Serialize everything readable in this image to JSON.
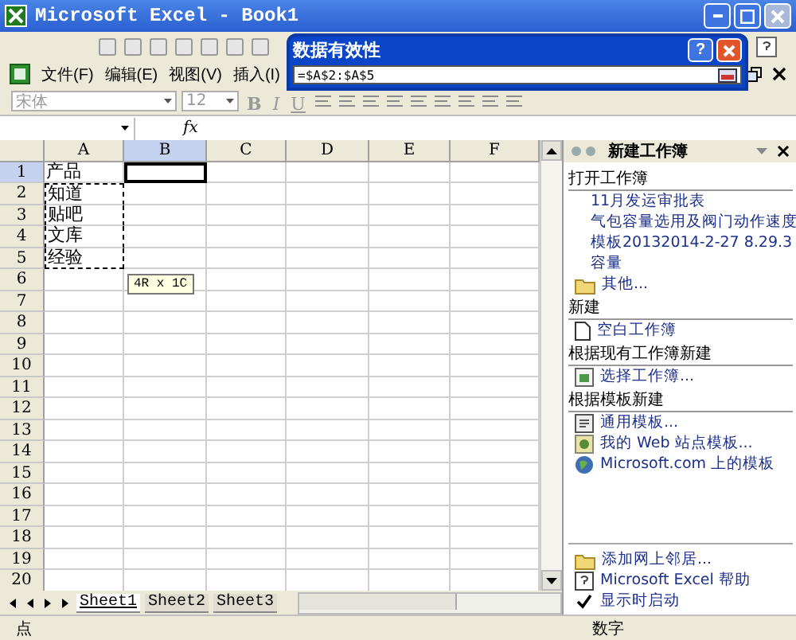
{
  "window": {
    "title": "Microsoft Excel - Book1"
  },
  "menu": [
    {
      "label": "文件(F)"
    },
    {
      "label": "编辑(E)"
    },
    {
      "label": "视图(V)"
    },
    {
      "label": "插入(I)"
    }
  ],
  "format_toolbar": {
    "font": "宋体",
    "size": "12",
    "buttons": [
      "B",
      "I",
      "U"
    ]
  },
  "formula_bar": {
    "fx": "fx"
  },
  "dialog": {
    "title": "数据有效性",
    "help": "?",
    "value": "=$A$2:$A$5"
  },
  "grid": {
    "columns": [
      {
        "label": "A",
        "selected": false
      },
      {
        "label": "B",
        "selected": true
      },
      {
        "label": "C",
        "selected": false
      },
      {
        "label": "D",
        "selected": false
      },
      {
        "label": "E",
        "selected": false
      },
      {
        "label": "F",
        "selected": false
      }
    ],
    "rows": [
      {
        "header": "1",
        "selected": true,
        "value": "产品",
        "marquee": false
      },
      {
        "header": "2",
        "selected": false,
        "value": "知道",
        "marquee": true
      },
      {
        "header": "3",
        "selected": false,
        "value": "贴吧",
        "marquee": true
      },
      {
        "header": "4",
        "selected": false,
        "value": "文库",
        "marquee": true
      },
      {
        "header": "5",
        "selected": false,
        "value": "经验",
        "marquee": true
      },
      {
        "header": "6",
        "selected": false,
        "marquee": false
      },
      {
        "header": "7",
        "selected": false,
        "marquee": false
      },
      {
        "header": "8",
        "selected": false,
        "marquee": false
      },
      {
        "header": "9",
        "selected": false,
        "marquee": false
      },
      {
        "header": "10",
        "selected": false,
        "marquee": false
      },
      {
        "header": "11",
        "selected": false,
        "marquee": false
      },
      {
        "header": "12",
        "selected": false,
        "marquee": false
      },
      {
        "header": "13",
        "selected": false,
        "marquee": false
      },
      {
        "header": "14",
        "selected": false,
        "marquee": false
      },
      {
        "header": "15",
        "selected": false,
        "marquee": false
      },
      {
        "header": "16",
        "selected": false,
        "marquee": false
      },
      {
        "header": "17",
        "selected": false,
        "marquee": false
      },
      {
        "header": "18",
        "selected": false,
        "marquee": false
      },
      {
        "header": "19",
        "selected": false,
        "marquee": false
      },
      {
        "header": "20",
        "selected": false,
        "marquee": false
      }
    ],
    "tooltip": "4R x 1C"
  },
  "sheet_tabs": [
    {
      "label": "Sheet1",
      "selected": true
    },
    {
      "label": "Sheet2",
      "selected": false
    },
    {
      "label": "Sheet3",
      "selected": false
    }
  ],
  "task_pane": {
    "title": "新建工作簿",
    "sections": [
      {
        "heading": "打开工作簿",
        "items": [
          {
            "text": "11月发运审批表",
            "kind": "text"
          },
          {
            "text": "气包容量选用及阀门动作速度",
            "kind": "text"
          },
          {
            "text": "模板20132014-2-27 8.29.3",
            "kind": "text"
          },
          {
            "text": "容量",
            "kind": "text"
          },
          {
            "text": "其他...",
            "kind": "folder"
          }
        ]
      },
      {
        "heading": "新建",
        "items": [
          {
            "text": "空白工作簿",
            "kind": "blank"
          }
        ]
      },
      {
        "heading": "根据现有工作簿新建",
        "items": [
          {
            "text": "选择工作簿...",
            "kind": "workbook"
          }
        ]
      },
      {
        "heading": "根据模板新建",
        "items": [
          {
            "text": "通用模板...",
            "kind": "template"
          },
          {
            "text": "我的 Web 站点模板...",
            "kind": "web"
          },
          {
            "text": "Microsoft.com 上的模板",
            "kind": "globe"
          }
        ]
      }
    ],
    "footer": [
      {
        "text": "添加网上邻居...",
        "kind": "folder"
      },
      {
        "text": "Microsoft Excel 帮助",
        "kind": "help"
      },
      {
        "text": "显示时启动",
        "kind": "check",
        "checked": true
      }
    ]
  },
  "status_bar": {
    "mode": "点",
    "num": "数字"
  }
}
